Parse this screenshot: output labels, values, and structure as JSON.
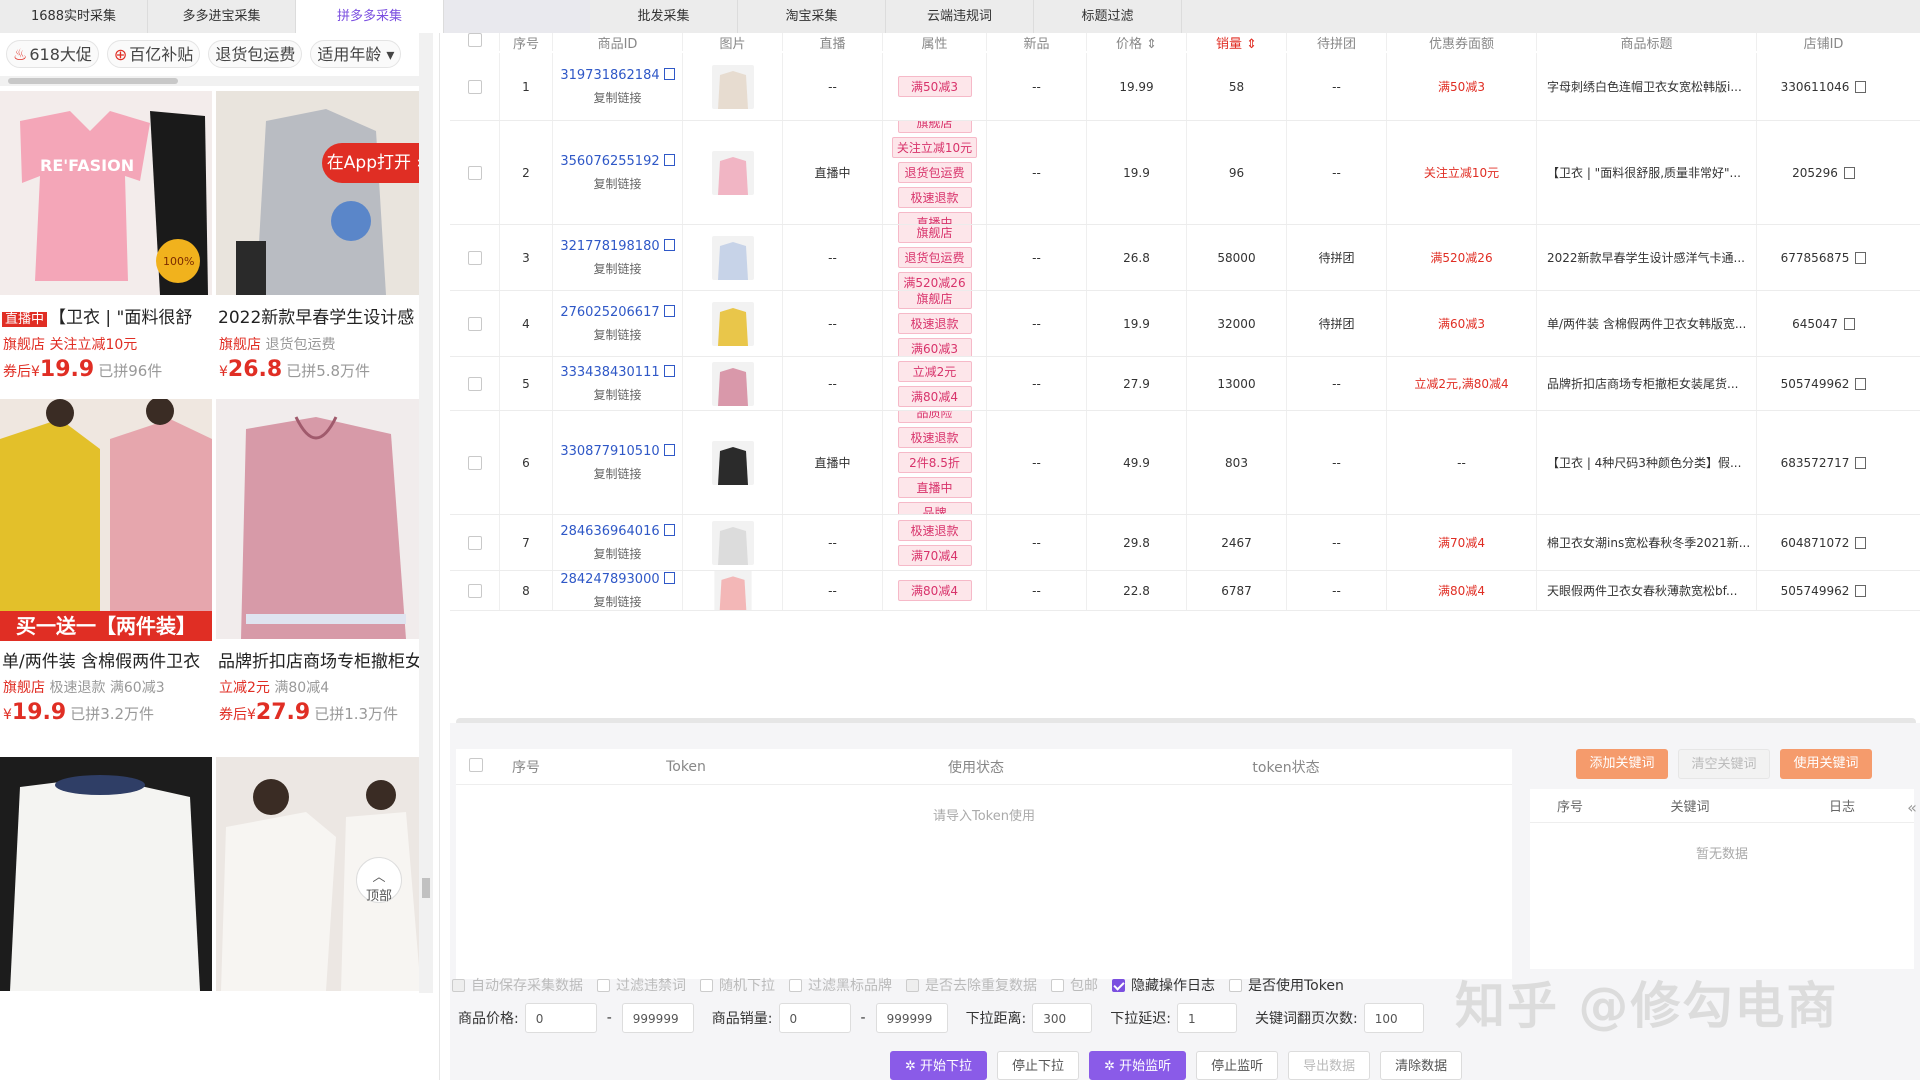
{
  "tabs": [
    "1688实时采集",
    "多多进宝采集",
    "拼多多采集",
    "批发采集",
    "淘宝采集",
    "云端违规词",
    "标题过滤"
  ],
  "left": {
    "chips": [
      "618大促",
      "百亿补贴",
      "退货包运费",
      "适用年龄"
    ],
    "app_button": "在App打开",
    "products": [
      {
        "live": "直播中",
        "title": "【卫衣 | \"面料很舒",
        "tags": "旗舰店  关注立减10元",
        "price_prefix": "券后¥",
        "price": "19.9",
        "sold": "已拼96件"
      },
      {
        "title": "2022新款早春学生设计感",
        "tags": "旗舰店",
        "tags_gray": "退货包运费",
        "price_prefix": "¥",
        "price": "26.8",
        "sold": "已拼5.8万件"
      },
      {
        "banner": "买一送一【两件装】",
        "title": "单/两件装 含棉假两件卫衣",
        "tags": "旗舰店",
        "tags_gray": "极速退款  满60减3",
        "price_prefix": "¥",
        "price": "19.9",
        "sold": "已拼3.2万件"
      },
      {
        "title": "品牌折扣店商场专柜撤柜女",
        "tags": "立减2元",
        "tags_gray": "满80减4",
        "price_prefix": "券后¥",
        "price": "27.9",
        "sold": "已拼1.3万件"
      }
    ],
    "top_button": "顶部"
  },
  "table": {
    "headers": [
      "序号",
      "商品ID",
      "图片",
      "直播",
      "属性",
      "新品",
      "价格",
      "销量",
      "待拼团",
      "优惠券面额",
      "商品标题",
      "店铺ID"
    ],
    "copy_label": "复制链接",
    "rows": [
      {
        "idx": "1",
        "id": "319731862184",
        "live": "--",
        "attrs": [
          "满50减3"
        ],
        "new": "--",
        "price": "19.99",
        "sales": "58",
        "group": "--",
        "coupon": "满50减3",
        "title": "字母刺绣白色连帽卫衣女宽松韩版i...",
        "shop": "330611046"
      },
      {
        "idx": "2",
        "id": "356076255192",
        "live": "直播中",
        "attrs": [
          "旗舰店",
          "关注立减10元",
          "退货包运费",
          "极速退款",
          "直播中"
        ],
        "new": "--",
        "price": "19.9",
        "sales": "96",
        "group": "--",
        "coupon": "关注立减10元",
        "title": "【卫衣 | \"面料很舒服,质量非常好\"...",
        "shop": "205296"
      },
      {
        "idx": "3",
        "id": "321778198180",
        "live": "--",
        "attrs": [
          "旗舰店",
          "退货包运费",
          "满520减26"
        ],
        "new": "--",
        "price": "26.8",
        "sales": "58000",
        "group": "待拼团",
        "coupon": "满520减26",
        "title": "2022新款早春学生设计感洋气卡通...",
        "shop": "677856875"
      },
      {
        "idx": "4",
        "id": "276025206617",
        "live": "--",
        "attrs": [
          "旗舰店",
          "极速退款",
          "满60减3"
        ],
        "new": "--",
        "price": "19.9",
        "sales": "32000",
        "group": "待拼团",
        "coupon": "满60减3",
        "title": "单/两件装 含棉假两件卫衣女韩版宽...",
        "shop": "645047"
      },
      {
        "idx": "5",
        "id": "333438430111",
        "live": "--",
        "attrs": [
          "立减2元",
          "满80减4"
        ],
        "new": "--",
        "price": "27.9",
        "sales": "13000",
        "group": "--",
        "coupon": "立减2元,满80减4",
        "title": "品牌折扣店商场专柜撤柜女装尾货...",
        "shop": "505749962"
      },
      {
        "idx": "6",
        "id": "330877910510",
        "live": "直播中",
        "attrs": [
          "品质险",
          "极速退款",
          "2件8.5折",
          "直播中",
          "品牌"
        ],
        "new": "--",
        "price": "49.9",
        "sales": "803",
        "group": "--",
        "coupon": "--",
        "title": "【卫衣 | 4种尺码3种颜色分类】假...",
        "shop": "683572717"
      },
      {
        "idx": "7",
        "id": "284636964016",
        "live": "--",
        "attrs": [
          "极速退款",
          "满70减4"
        ],
        "new": "--",
        "price": "29.8",
        "sales": "2467",
        "group": "--",
        "coupon": "满70减4",
        "title": "棉卫衣女潮ins宽松春秋冬季2021新...",
        "shop": "604871072"
      },
      {
        "idx": "8",
        "id": "284247893000",
        "live": "--",
        "attrs": [
          "满80减4"
        ],
        "new": "--",
        "price": "22.8",
        "sales": "6787",
        "group": "--",
        "coupon": "满80减4",
        "title": "天眼假两件卫衣女春秋薄款宽松bf...",
        "shop": "505749962"
      }
    ]
  },
  "token": {
    "headers": [
      "序号",
      "Token",
      "使用状态",
      "token状态"
    ],
    "empty": "请导入Token使用"
  },
  "keywords": {
    "buttons": [
      "添加关键词",
      "清空关键词",
      "使用关键词"
    ],
    "headers": [
      "序号",
      "关键词",
      "日志"
    ],
    "empty": "暂无数据"
  },
  "options": [
    {
      "label": "自动保存采集数据",
      "checked": true,
      "enabled": false
    },
    {
      "label": "过滤违禁词",
      "checked": false,
      "enabled": false
    },
    {
      "label": "随机下拉",
      "checked": false,
      "enabled": false
    },
    {
      "label": "过滤黑标品牌",
      "checked": false,
      "enabled": false
    },
    {
      "label": "是否去除重复数据",
      "checked": true,
      "enabled": false
    },
    {
      "label": "包邮",
      "checked": false,
      "enabled": false
    },
    {
      "label": "隐藏操作日志",
      "checked": true,
      "enabled": true
    },
    {
      "label": "是否使用Token",
      "checked": false,
      "enabled": true
    }
  ],
  "fields": {
    "price_label": "商品价格:",
    "price_min": "0",
    "price_max": "999999",
    "sales_label": "商品销量:",
    "sales_min": "0",
    "sales_max": "999999",
    "distance_label": "下拉距离:",
    "distance": "300",
    "delay_label": "下拉延迟:",
    "delay": "1",
    "pages_label": "关键词翻页次数:",
    "pages": "100"
  },
  "actions": [
    "开始下拉",
    "停止下拉",
    "开始监听",
    "停止监听",
    "导出数据",
    "清除数据"
  ],
  "watermark": "知乎 @修勾电商"
}
